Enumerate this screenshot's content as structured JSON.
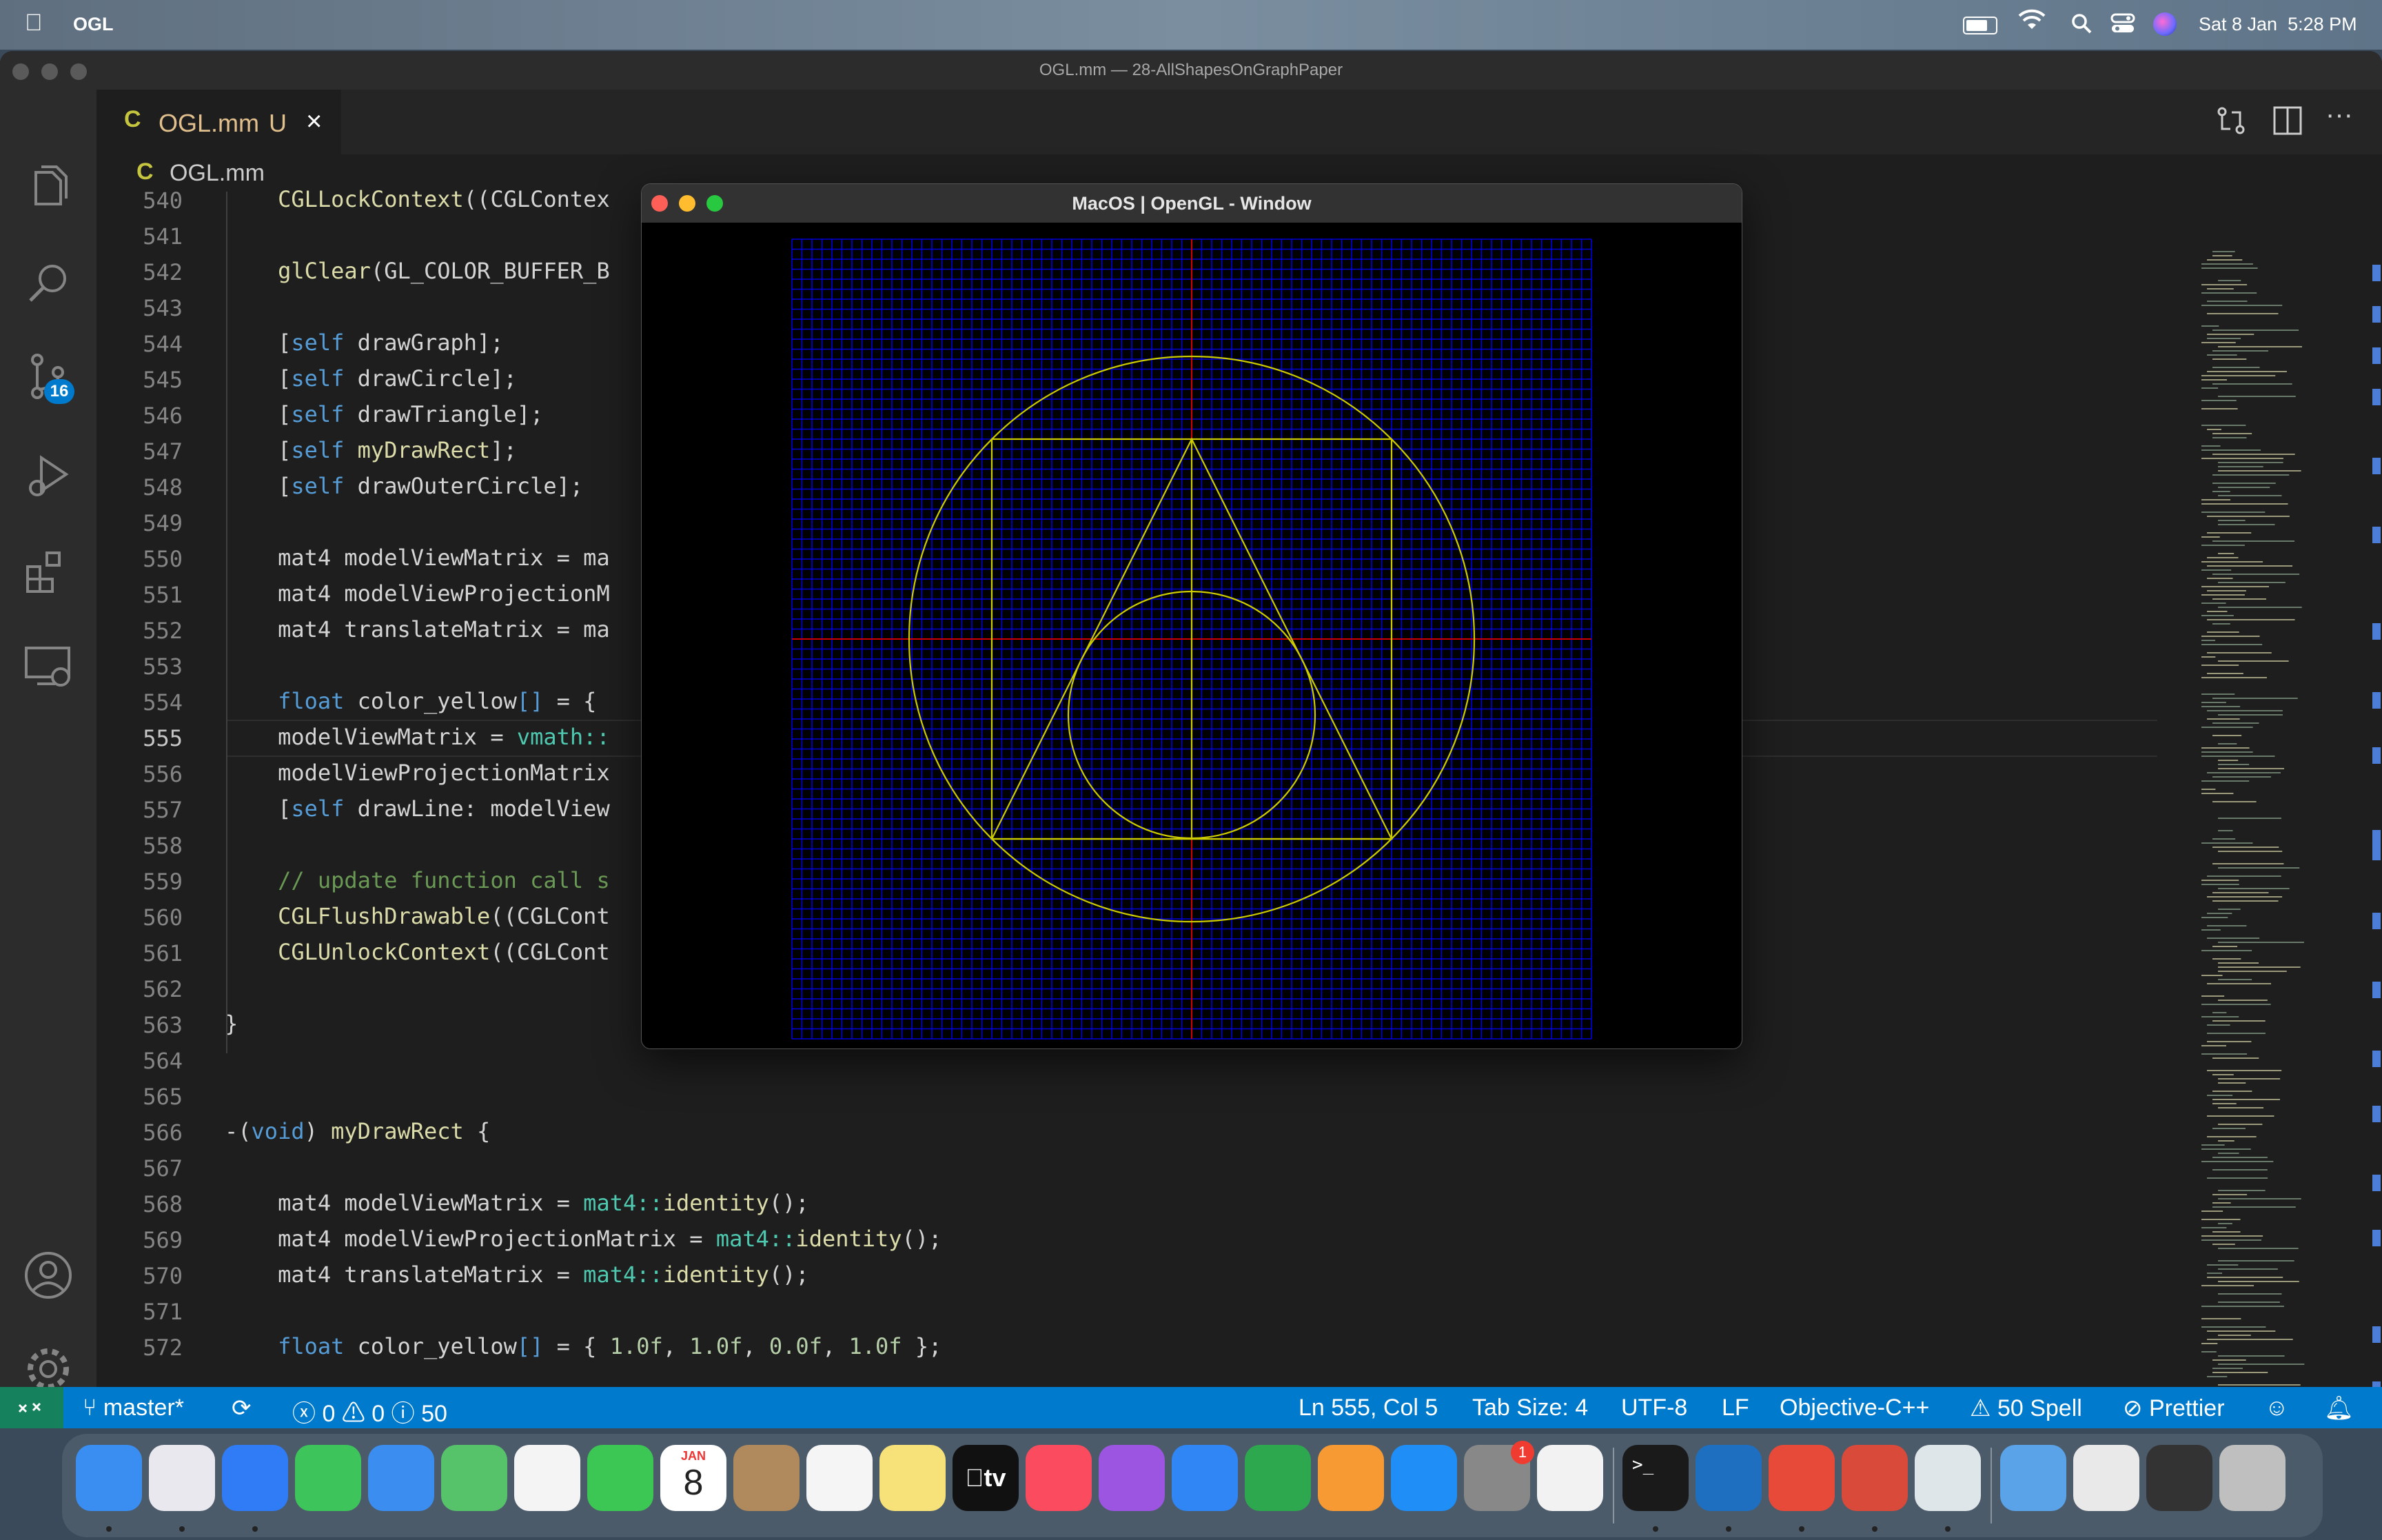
{
  "menubar": {
    "app_name": "OGL",
    "datetime": "Sat 8 Jan  5:28 PM"
  },
  "window": {
    "title": "OGL.mm — 28-AllShapesOnGraphPaper"
  },
  "tab": {
    "name": "OGL.mm",
    "status": "U"
  },
  "breadcrumb": {
    "file": "OGL.mm"
  },
  "activity": {
    "scm_badge": "16"
  },
  "editor": {
    "current_line": 555,
    "lines": [
      {
        "n": "540",
        "t": "    CGLLockContext((CGLContex"
      },
      {
        "n": "541",
        "t": ""
      },
      {
        "n": "542",
        "t": "    glClear(GL_COLOR_BUFFER_B"
      },
      {
        "n": "543",
        "t": ""
      },
      {
        "n": "544",
        "t": "    [self drawGraph];"
      },
      {
        "n": "545",
        "t": "    [self drawCircle];"
      },
      {
        "n": "546",
        "t": "    [self drawTriangle];"
      },
      {
        "n": "547",
        "t": "    [self myDrawRect];"
      },
      {
        "n": "548",
        "t": "    [self drawOuterCircle];"
      },
      {
        "n": "549",
        "t": ""
      },
      {
        "n": "550",
        "t": "    mat4 modelViewMatrix = ma"
      },
      {
        "n": "551",
        "t": "    mat4 modelViewProjectionM"
      },
      {
        "n": "552",
        "t": "    mat4 translateMatrix = ma"
      },
      {
        "n": "553",
        "t": ""
      },
      {
        "n": "554",
        "t": "    float color_yellow[] = {"
      },
      {
        "n": "555",
        "t": "    modelViewMatrix = vmath::"
      },
      {
        "n": "556",
        "t": "    modelViewProjectionMatrix"
      },
      {
        "n": "557",
        "t": "    [self drawLine: modelView"
      },
      {
        "n": "558",
        "t": ""
      },
      {
        "n": "559",
        "t": "    // update function call s"
      },
      {
        "n": "560",
        "t": "    CGLFlushDrawable((CGLCont"
      },
      {
        "n": "561",
        "t": "    CGLUnlockContext((CGLCont"
      },
      {
        "n": "562",
        "t": ""
      },
      {
        "n": "563",
        "t": "}"
      },
      {
        "n": "564",
        "t": ""
      },
      {
        "n": "565",
        "t": ""
      },
      {
        "n": "566",
        "t": "-(void) myDrawRect {"
      },
      {
        "n": "567",
        "t": ""
      },
      {
        "n": "568",
        "t": "    mat4 modelViewMatrix = mat4::identity();"
      },
      {
        "n": "569",
        "t": "    mat4 modelViewProjectionMatrix = mat4::identity();"
      },
      {
        "n": "570",
        "t": "    mat4 translateMatrix = mat4::identity();"
      },
      {
        "n": "571",
        "t": ""
      },
      {
        "n": "572",
        "t": "    float color_yellow[] = { 1.0f, 1.0f, 0.0f, 1.0f };"
      }
    ]
  },
  "statusbar": {
    "branch": "master*",
    "errors": "0",
    "warnings": "0",
    "infos": "50",
    "position": "Ln 555, Col 5",
    "tab_size": "Tab Size: 4",
    "encoding": "UTF-8",
    "eol": "LF",
    "language": "Objective-C++",
    "spell": "50 Spell",
    "formatter": "Prettier"
  },
  "gl_window": {
    "title": "MacOS | OpenGL - Window"
  },
  "dock": {
    "calendar_month": "JAN",
    "calendar_day": "8",
    "settings_badge": "1",
    "apps": [
      "finder-icon",
      "launchpad-icon",
      "safari-icon",
      "messages-icon",
      "mail-icon",
      "maps-icon",
      "photos-icon",
      "facetime-icon",
      "calendar-icon",
      "contacts-icon",
      "reminders-icon",
      "notes-icon",
      "tv-icon",
      "music-icon",
      "podcasts-icon",
      "keynote-icon",
      "numbers-icon",
      "pages-icon",
      "app-store-icon",
      "system-preferences-icon",
      "textedit-icon",
      "terminal-icon",
      "vscode-icon",
      "git-icon",
      "git-client-icon",
      "preview-icon",
      "downloads-icon",
      "documents-stack-icon",
      "screenshots-stack-icon",
      "trash-icon"
    ],
    "tv_label": "tv"
  },
  "colors": {
    "statusbar": "#007acc",
    "accent_yellow": "#cccc00",
    "grid_blue": "#0000ff"
  }
}
